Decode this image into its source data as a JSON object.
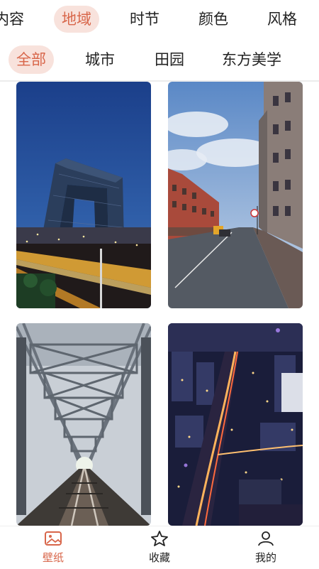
{
  "category_tabs": [
    {
      "label": "内容",
      "active": false
    },
    {
      "label": "地域",
      "active": true
    },
    {
      "label": "时节",
      "active": false
    },
    {
      "label": "颜色",
      "active": false
    },
    {
      "label": "风格",
      "active": false
    }
  ],
  "sub_tabs": [
    {
      "label": "全部",
      "active": true
    },
    {
      "label": "城市",
      "active": false
    },
    {
      "label": "田园",
      "active": false
    },
    {
      "label": "东方美学",
      "active": false
    }
  ],
  "wallpapers": [
    {
      "subject": "cctv-tower-night"
    },
    {
      "subject": "european-street"
    },
    {
      "subject": "railway-bridge"
    },
    {
      "subject": "city-night-aerial"
    }
  ],
  "bottom_nav": [
    {
      "label": "壁纸",
      "icon": "image-icon",
      "active": true
    },
    {
      "label": "收藏",
      "icon": "star-icon",
      "active": false
    },
    {
      "label": "我的",
      "icon": "person-icon",
      "active": false
    }
  ],
  "colors": {
    "accent": "#d8664a",
    "accent_bg": "#f8e2dc"
  }
}
